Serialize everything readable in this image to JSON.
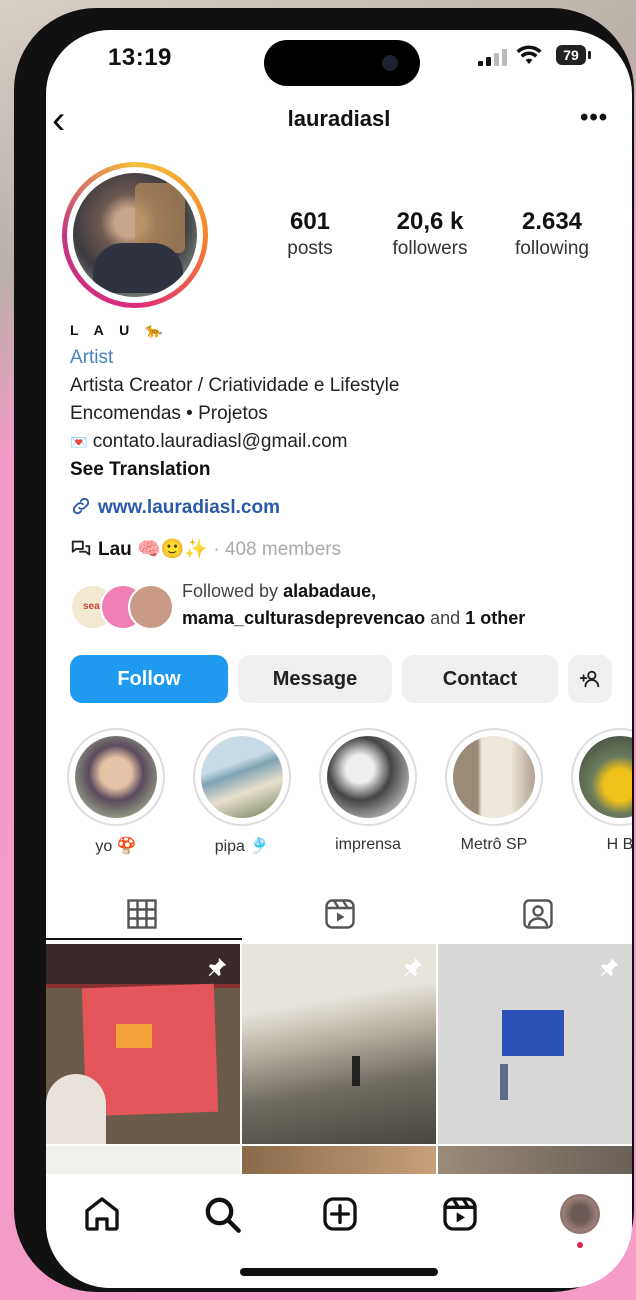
{
  "status": {
    "time": "13:19",
    "battery": "79"
  },
  "header": {
    "username": "lauradiasl",
    "more": "•••",
    "back": "‹"
  },
  "stats": [
    {
      "value": "601",
      "label": "posts"
    },
    {
      "value": "20,6 k",
      "label": "followers"
    },
    {
      "value": "2.634",
      "label": "following"
    }
  ],
  "bio": {
    "name": "L A U 🐆",
    "category": "Artist",
    "line1": "Artista Creator / Criatividade e Lifestyle",
    "line2": "Encomendas • Projetos",
    "email_emoji": "💌",
    "email": "contato.lauradiasl@gmail.com",
    "see_translation": "See Translation",
    "website": "www.lauradiasl.com",
    "community_name": "Lau 🧠🙂✨",
    "community_sep": "·",
    "community_members": "408 members"
  },
  "followed_by": {
    "prefix": "Followed by",
    "user1": "alabadaue,",
    "user2": "mama_culturasdeprevencao",
    "conj": "and",
    "others": "1 other",
    "avatar_label": "seat"
  },
  "buttons": {
    "follow": "Follow",
    "message": "Message",
    "contact": "Contact"
  },
  "highlights": [
    {
      "label": "yo 🍄"
    },
    {
      "label": "pipa 🎐"
    },
    {
      "label": "imprensa"
    },
    {
      "label": "Metrô SP"
    },
    {
      "label": "H B"
    }
  ],
  "colors": {
    "follow_blue": "#1e9bf0",
    "link_blue": "#2b5aa8",
    "category_blue": "#4a7fc1"
  }
}
